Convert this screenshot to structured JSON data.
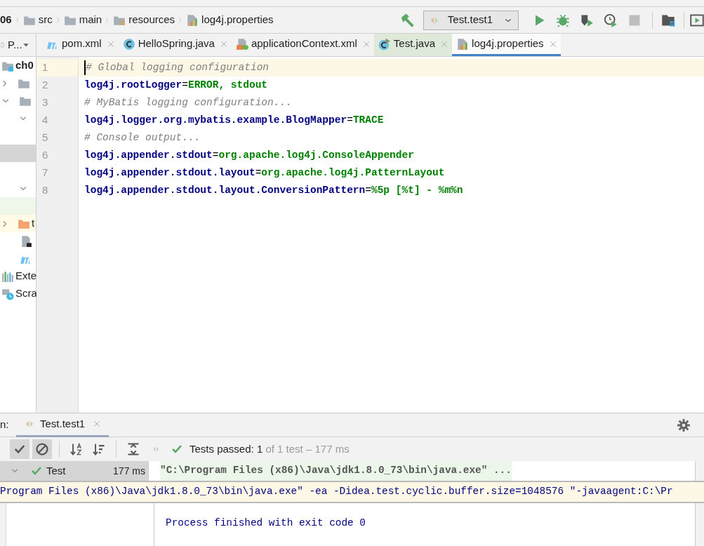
{
  "breadcrumbs": [
    {
      "label": "06",
      "kind": "module"
    },
    {
      "label": "src",
      "kind": "folder"
    },
    {
      "label": "main",
      "kind": "folder"
    },
    {
      "label": "resources",
      "kind": "resources"
    },
    {
      "label": "log4j.properties",
      "kind": "properties"
    }
  ],
  "run_config": {
    "label": "Test.test1"
  },
  "project_panel": {
    "title": "P...",
    "items": [
      {
        "label": "ch0",
        "kind": "module",
        "selected": false
      },
      {
        "kind": "folder",
        "expanded": false,
        "selected": false
      },
      {
        "kind": "folder",
        "expanded": true,
        "selected": false
      },
      {
        "kind": "none",
        "expanded": true,
        "selected": false
      },
      {
        "kind": "none",
        "selected": false
      },
      {
        "kind": "none",
        "selected": true
      },
      {
        "kind": "none",
        "selected": false
      },
      {
        "kind": "none",
        "expanded": true,
        "selected": false
      },
      {
        "kind": "none",
        "selected": false
      },
      {
        "label": "t",
        "kind": "orange-folder",
        "expanded": false,
        "selected": false
      },
      {
        "kind": "file",
        "selected": false
      },
      {
        "kind": "maven",
        "selected": false
      },
      {
        "label": "Exte",
        "kind": "libraries",
        "selected": false
      },
      {
        "label": "Scra",
        "kind": "scratches",
        "selected": false
      }
    ]
  },
  "tabs": [
    {
      "label": "pom.xml",
      "kind": "maven",
      "selected": false
    },
    {
      "label": "HelloSpring.java",
      "kind": "class",
      "selected": false
    },
    {
      "label": "applicationContext.xml",
      "kind": "xml",
      "selected": false
    },
    {
      "label": "Test.java",
      "kind": "test-class",
      "selected": false
    },
    {
      "label": "log4j.properties",
      "kind": "properties",
      "selected": true
    }
  ],
  "editor": {
    "lines": [
      {
        "number": "1",
        "current": true,
        "parts": [
          {
            "text": "# Global logging configuration",
            "kind": "comment"
          }
        ]
      },
      {
        "number": "2",
        "current": false,
        "parts": [
          {
            "text": "log4j.rootLogger",
            "kind": "key"
          },
          {
            "text": "=",
            "kind": "sep"
          },
          {
            "text": "ERROR, stdout",
            "kind": "value"
          }
        ]
      },
      {
        "number": "3",
        "current": false,
        "parts": [
          {
            "text": "# MyBatis logging configuration...",
            "kind": "comment"
          }
        ]
      },
      {
        "number": "4",
        "current": false,
        "parts": [
          {
            "text": "log4j.logger.org.mybatis.example.BlogMapper",
            "kind": "key"
          },
          {
            "text": "=",
            "kind": "sep"
          },
          {
            "text": "TRACE",
            "kind": "value"
          }
        ]
      },
      {
        "number": "5",
        "current": false,
        "parts": [
          {
            "text": "# Console output...",
            "kind": "comment"
          }
        ]
      },
      {
        "number": "6",
        "current": false,
        "parts": [
          {
            "text": "log4j.appender.stdout",
            "kind": "key"
          },
          {
            "text": "=",
            "kind": "sep"
          },
          {
            "text": "org.apache.log4j.ConsoleAppender",
            "kind": "value"
          }
        ]
      },
      {
        "number": "7",
        "current": false,
        "parts": [
          {
            "text": "log4j.appender.stdout.layout",
            "kind": "key"
          },
          {
            "text": "=",
            "kind": "sep"
          },
          {
            "text": "org.apache.log4j.PatternLayout",
            "kind": "value"
          }
        ]
      },
      {
        "number": "8",
        "current": false,
        "parts": [
          {
            "text": "log4j.appender.stdout.layout.ConversionPattern",
            "kind": "key"
          },
          {
            "text": "=",
            "kind": "sep"
          },
          {
            "text": "%5p [%t] - %m%n",
            "kind": "value"
          }
        ]
      }
    ]
  },
  "run_panel": {
    "label": "n:",
    "tab": "Test.test1",
    "toolbar": [
      {
        "kind": "check",
        "selected": true
      },
      {
        "kind": "ignored",
        "selected": true
      },
      {
        "kind": "sort-alpha",
        "selected": false
      },
      {
        "kind": "sort-duration",
        "selected": false
      },
      {
        "kind": "expand",
        "selected": false
      },
      {
        "kind": "more",
        "selected": false
      }
    ],
    "status": "Tests passed: **1** of 1 test – 177 ms",
    "tests": [
      {
        "label": "Test",
        "time": "177 ms",
        "passed": true
      }
    ],
    "console": [
      {
        "text": "\"C:\\Program Files (x86)\\Java\\jdk1.8.0_73\\bin\\java.exe\" ...",
        "kind": "command"
      },
      {
        "text": "Program Files (x86)\\Java\\jdk1.8.0_73\\bin\\java.exe\" -ea -Didea.test.cyclic.buffer.size=1048576 \"-javaagent:C:\\Pr",
        "kind": "expanded"
      },
      {
        "text": "Process finished with exit code 0",
        "kind": "output"
      }
    ]
  }
}
